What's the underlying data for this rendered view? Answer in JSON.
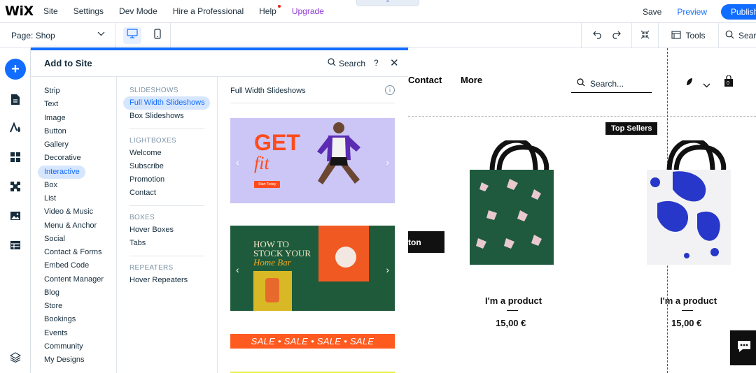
{
  "topbar": {
    "logo": "WiX",
    "nav": [
      "Site",
      "Settings",
      "Dev Mode",
      "Hire a Professional",
      "Help",
      "Upgrade"
    ],
    "save": "Save",
    "preview": "Preview",
    "publish": "Publish",
    "accent": "#116dff",
    "upgrade_color": "#8d3ad3"
  },
  "secbar": {
    "page_label": "Page: Shop",
    "tools": "Tools",
    "search": "Sear"
  },
  "panel": {
    "title": "Add to Site",
    "search": "Search",
    "help": "?",
    "categories": [
      "Strip",
      "Text",
      "Image",
      "Button",
      "Gallery",
      "Decorative",
      "Interactive",
      "Box",
      "List",
      "Video & Music",
      "Menu & Anchor",
      "Social",
      "Contact & Forms",
      "Embed Code",
      "Content Manager",
      "Blog",
      "Store",
      "Bookings",
      "Events",
      "Community",
      "My Designs"
    ],
    "active_category": "Interactive",
    "sections": [
      {
        "heading": "SLIDESHOWS",
        "items": [
          "Full Width Slideshows",
          "Box Slideshows"
        ]
      },
      {
        "heading": "LIGHTBOXES",
        "items": [
          "Welcome",
          "Subscribe",
          "Promotion",
          "Contact"
        ]
      },
      {
        "heading": "BOXES",
        "items": [
          "Hover Boxes",
          "Tabs"
        ]
      },
      {
        "heading": "REPEATERS",
        "items": [
          "Hover Repeaters"
        ]
      }
    ],
    "active_item": "Full Width Slideshows",
    "preview_heading": "Full Width Slideshows",
    "thumb1": {
      "headline1": "GET",
      "headline2": "fit",
      "cta": "Start Today"
    },
    "thumb2": {
      "line1": "HOW TO",
      "line2": "STOCK YOUR",
      "line3": "Home Bar"
    },
    "thumb3": "SALE • SALE • SALE • SALE"
  },
  "site": {
    "nav": [
      "Contact",
      "More"
    ],
    "search_placeholder": "Search...",
    "cart_count": "0",
    "badge": "Top Sellers",
    "button_text": "ton",
    "products": [
      {
        "name": "I'm a product",
        "price": "15,00 €"
      },
      {
        "name": "I'm a product",
        "price": "15,00 €"
      }
    ]
  }
}
